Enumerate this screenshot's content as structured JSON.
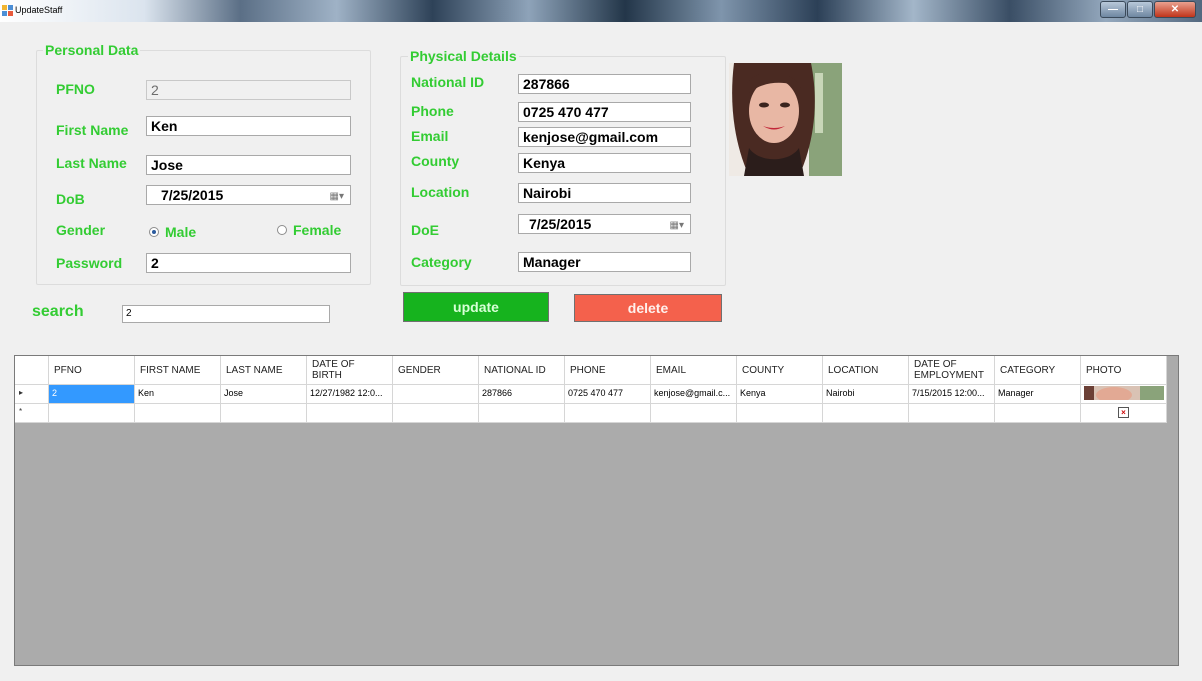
{
  "window": {
    "title": "UpdateStaff"
  },
  "personal": {
    "title": "Personal Data",
    "pfno_label": "PFNO",
    "pfno_value": "2",
    "first_name_label": "First Name",
    "first_name_value": "Ken",
    "last_name_label": "Last Name",
    "last_name_value": "Jose",
    "dob_label": "DoB",
    "dob_value": "7/25/2015",
    "gender_label": "Gender",
    "gender_male": "Male",
    "gender_female": "Female",
    "gender_selected": "Male",
    "password_label": "Password",
    "password_value": "2"
  },
  "physical": {
    "title": "Physical Details",
    "national_id_label": "National ID",
    "national_id_value": "287866",
    "phone_label": "Phone",
    "phone_value": "0725 470 477",
    "email_label": "Email",
    "email_value": "kenjose@gmail.com",
    "county_label": "County",
    "county_value": "Kenya",
    "location_label": "Location",
    "location_value": "Nairobi",
    "doe_label": "DoE",
    "doe_value": "7/25/2015",
    "category_label": "Category",
    "category_value": "Manager"
  },
  "search": {
    "label": "search",
    "value": "2"
  },
  "actions": {
    "update_label": "update",
    "delete_label": "delete"
  },
  "grid": {
    "columns": [
      "PFNO",
      "FIRST NAME",
      "LAST NAME",
      "DATE OF BIRTH",
      "GENDER",
      "NATIONAL ID",
      "PHONE",
      "EMAIL",
      "COUNTY",
      "LOCATION",
      "DATE OF EMPLOYMENT",
      "CATEGORY",
      "PHOTO"
    ],
    "rows": [
      {
        "marker": "▸",
        "cells": [
          "2",
          "Ken",
          "Jose",
          "12/27/1982 12:0...",
          "",
          "287866",
          "0725 470 477",
          "kenjose@gmail.c...",
          "Kenya",
          "Nairobi",
          "7/15/2015 12:00...",
          "Manager",
          ""
        ]
      }
    ],
    "new_row_marker": "*"
  },
  "colors": {
    "label_green": "#33cc33",
    "update_bg": "#16b31e",
    "delete_bg": "#f4614c",
    "selection": "#3399ff"
  }
}
